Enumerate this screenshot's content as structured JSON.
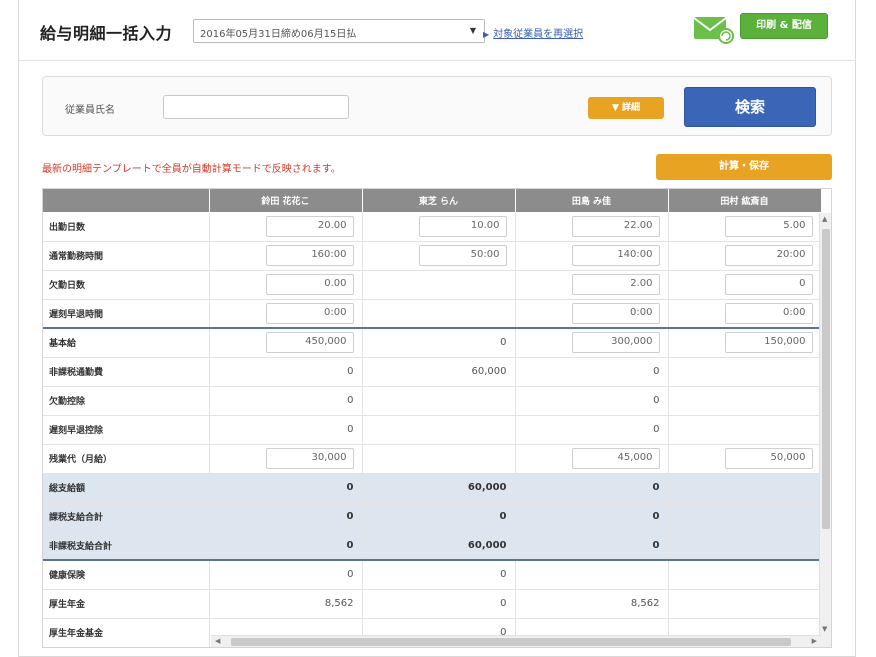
{
  "header": {
    "title": "給与明細一括入力",
    "period": "2016年05月31日締め06月15日払",
    "reselect": "対象従業員を再選択",
    "print_label": "印刷 & 配信"
  },
  "search": {
    "employee_label": "従業員氏名",
    "employee_value": "",
    "detail_label": "▼ 詳細",
    "search_label": "検索"
  },
  "notice": "最新の明細テンプレートで全員が自動計算モードで反映されます。",
  "calc_label": "計算・保存",
  "table": {
    "columns": [
      "",
      "鈴田 花花こ",
      "東芝 らん",
      "田島 み佳",
      "田村 紘斎自"
    ],
    "rows": [
      {
        "label": "出勤日数",
        "cells": [
          "20.00",
          "10.00",
          "22.00",
          "5.00"
        ],
        "boxed": [
          true,
          true,
          true,
          true
        ]
      },
      {
        "label": "通常勤務時間",
        "cells": [
          "160:00",
          "50:00",
          "140:00",
          "20:00"
        ],
        "boxed": [
          true,
          true,
          true,
          true
        ]
      },
      {
        "label": "欠勤日数",
        "cells": [
          "0.00",
          "",
          "2.00",
          "0"
        ],
        "boxed": [
          true,
          false,
          true,
          true
        ]
      },
      {
        "label": "遅刻早退時間",
        "cells": [
          "0:00",
          "",
          "0:00",
          "0:00"
        ],
        "boxed": [
          true,
          false,
          true,
          true
        ]
      },
      {
        "label": "基本給",
        "cells": [
          "450,000",
          "0",
          "300,000",
          "150,000"
        ],
        "boxed": [
          true,
          false,
          true,
          true
        ]
      },
      {
        "label": "非課税通勤費",
        "cells": [
          "0",
          "60,000",
          "0",
          ""
        ],
        "boxed": [
          false,
          false,
          false,
          false
        ]
      },
      {
        "label": "欠勤控除",
        "cells": [
          "0",
          "",
          "0",
          ""
        ],
        "boxed": [
          false,
          false,
          false,
          false
        ]
      },
      {
        "label": "遅刻早退控除",
        "cells": [
          "0",
          "",
          "0",
          ""
        ],
        "boxed": [
          false,
          false,
          false,
          false
        ]
      },
      {
        "label": "残業代（月給）",
        "cells": [
          "30,000",
          "",
          "45,000",
          "50,000"
        ],
        "boxed": [
          true,
          false,
          true,
          true
        ]
      },
      {
        "label": "総支給額",
        "cells": [
          "0",
          "60,000",
          "0",
          ""
        ],
        "boxed": [
          false,
          false,
          false,
          false
        ]
      },
      {
        "label": "課税支給合計",
        "cells": [
          "0",
          "0",
          "0",
          ""
        ],
        "boxed": [
          false,
          false,
          false,
          false
        ]
      },
      {
        "label": "非課税支給合計",
        "cells": [
          "0",
          "60,000",
          "0",
          ""
        ],
        "boxed": [
          false,
          false,
          false,
          false
        ]
      },
      {
        "label": "健康保険",
        "cells": [
          "0",
          "0",
          "",
          ""
        ],
        "boxed": [
          false,
          false,
          false,
          false
        ]
      },
      {
        "label": "厚生年金",
        "cells": [
          "8,562",
          "0",
          "8,562",
          ""
        ],
        "boxed": [
          false,
          false,
          false,
          false
        ]
      },
      {
        "label": "厚生年金基金",
        "cells": [
          "",
          "0",
          "",
          ""
        ],
        "boxed": [
          false,
          false,
          false,
          false
        ]
      }
    ]
  }
}
